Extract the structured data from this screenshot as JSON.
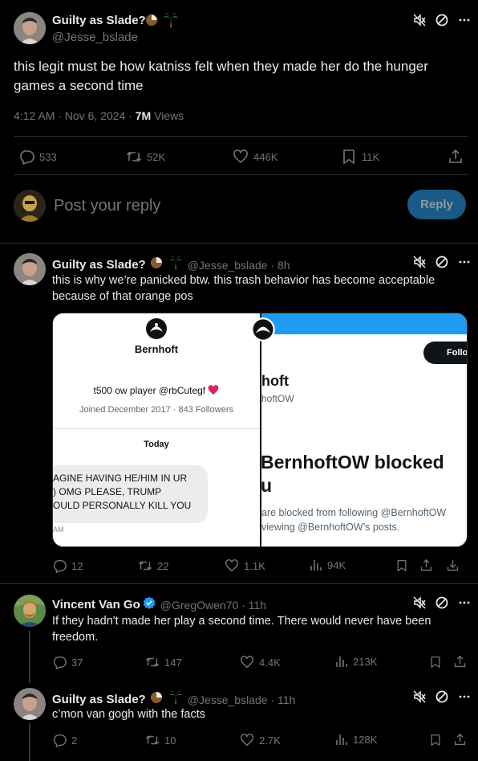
{
  "main_post": {
    "author_name": "Guilty as Slade?",
    "handle": "@Jesse_bslade",
    "text": "this legit must be how katniss felt when they made her do the hunger games a second time",
    "time": "4:12 AM · Nov 6, 2024 · ",
    "views_count": "7M",
    "views_label": " Views",
    "stats": {
      "replies": "533",
      "reposts": "52K",
      "likes": "446K",
      "bookmarks": "11K"
    }
  },
  "reply_box": {
    "placeholder": "Post your reply",
    "button_label": "Reply"
  },
  "reply1": {
    "author_name": "Guilty as Slade?",
    "meta": "@Jesse_bslade · 8h",
    "text": "this is why we’re panicked btw. this trash behavior has become acceptable because of that orange pos",
    "stats": {
      "replies": "12",
      "reposts": "22",
      "likes": "1.1K",
      "views": "94K"
    },
    "image_left": {
      "profile_name": "Bernhoft",
      "bio": "t500 ow player @rbCutegf",
      "joined": "Joined December 2017 · 843 Followers",
      "today": "Today",
      "message_lines": [
        "AGINE HAVING HE/HIM IN UR",
        ") OMG PLEASE, TRUMP",
        "OULD PERSONALLY KILL YOU"
      ],
      "time_fragment": "AM"
    },
    "image_right": {
      "follow_label": "Follo",
      "name_fragment": "hoft",
      "handle_fragment": "hoftOW",
      "blocked_title_1": "BernhoftOW blocked",
      "blocked_title_2": "u",
      "blocked_line_1": "are blocked from following @BernhoftOW",
      "blocked_line_2": "viewing @BernhoftOW’s posts."
    }
  },
  "reply2": {
    "author_name": "Vincent Van Go",
    "meta": "@GregOwen70 · 11h",
    "text": "If they hadn't made her play a second time. There would never have been freedom.",
    "stats": {
      "replies": "37",
      "reposts": "147",
      "likes": "4.4K",
      "views": "213K"
    }
  },
  "reply3": {
    "author_name": "Guilty as Slade?",
    "meta": "@Jesse_bslade · 11h",
    "text": "c’mon van gogh with the facts",
    "stats": {
      "replies": "2",
      "reposts": "10",
      "likes": "2.7K",
      "views": "128K"
    }
  },
  "colors": {
    "background": "#000000",
    "text": "#e7e9ea",
    "muted": "#71767b",
    "divider": "#2f3336",
    "accent": "#1d9bf0",
    "reply_button": "#1a5a86"
  }
}
